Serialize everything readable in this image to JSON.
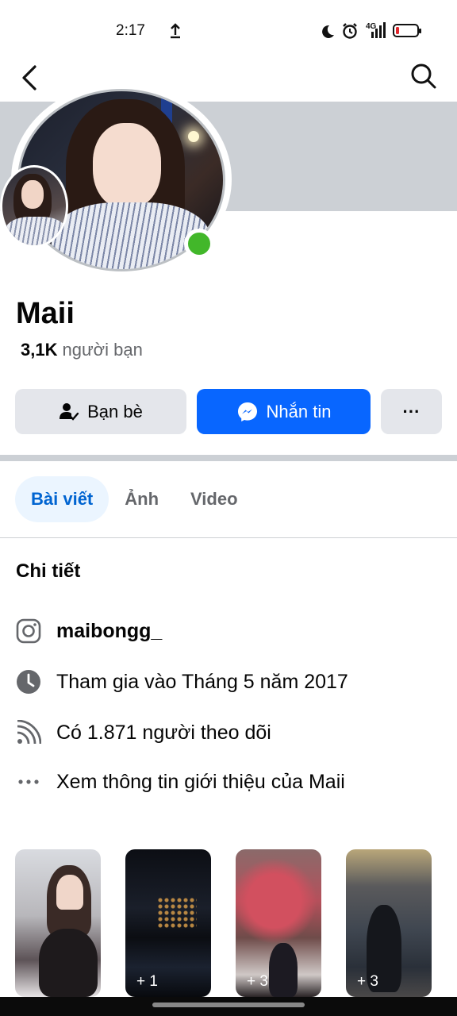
{
  "status_bar": {
    "time": "2:17",
    "network": "4G"
  },
  "nav": {
    "back_icon": "chevron-left-icon",
    "search_icon": "search-icon"
  },
  "profile": {
    "name": "Maii",
    "friends_count": "3,1K",
    "friends_label": "người bạn",
    "online": true
  },
  "actions": {
    "friends_label": "Bạn bè",
    "message_label": "Nhắn tin",
    "more_label": "···"
  },
  "tabs": [
    {
      "label": "Bài viết",
      "active": true
    },
    {
      "label": "Ảnh",
      "active": false
    },
    {
      "label": "Video",
      "active": false
    }
  ],
  "details": {
    "title": "Chi tiết",
    "instagram": "maibongg_",
    "joined": "Tham gia vào Tháng 5 năm 2017",
    "followers": "Có 1.871 người theo dõi",
    "about": "Xem thông tin giới thiệu của Maii"
  },
  "photos": [
    {
      "count": ""
    },
    {
      "count": "+ 1"
    },
    {
      "count": "+ 3"
    },
    {
      "count": "+ 3"
    }
  ],
  "colors": {
    "accent": "#0866ff",
    "tab_active_bg": "#ebf5ff",
    "tab_active_text": "#0064d1",
    "online": "#42b72a",
    "button_gray": "#e4e6eb"
  }
}
